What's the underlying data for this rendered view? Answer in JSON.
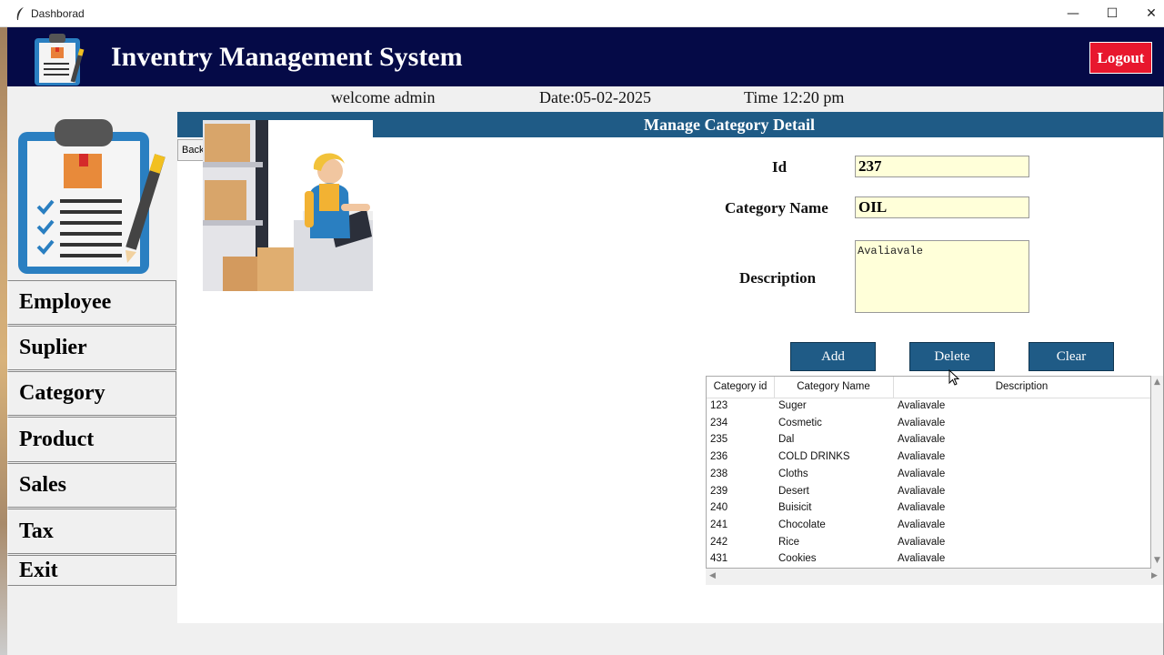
{
  "window": {
    "title": "Dashborad",
    "controls": [
      "—",
      "☐",
      "✕"
    ]
  },
  "header": {
    "title": "Inventry Management System",
    "logout_label": "Logout"
  },
  "info": {
    "welcome": "welcome admin",
    "date": "Date:05-02-2025",
    "time": "Time 12:20 pm"
  },
  "sidebar": {
    "items": [
      {
        "label": "Employee"
      },
      {
        "label": "Suplier"
      },
      {
        "label": "Category"
      },
      {
        "label": "Product"
      },
      {
        "label": "Sales"
      },
      {
        "label": "Tax"
      },
      {
        "label": "Exit"
      }
    ]
  },
  "content": {
    "title": "Manage Category Detail",
    "back_label": "Back"
  },
  "form": {
    "id_label": "Id",
    "id_value": "237",
    "name_label": "Category Name",
    "name_value": "OIL",
    "desc_label": "Description",
    "desc_value": "Avaliavale"
  },
  "buttons": {
    "add": "Add",
    "delete": "Delete",
    "clear": "Clear"
  },
  "table": {
    "columns": [
      "Category id",
      "Category Name",
      "Description"
    ],
    "rows": [
      [
        "123",
        "Suger",
        "Avaliavale"
      ],
      [
        "234",
        "Cosmetic",
        "Avaliavale"
      ],
      [
        "235",
        "Dal",
        "Avaliavale"
      ],
      [
        "236",
        "COLD DRINKS",
        "Avaliavale"
      ],
      [
        "238",
        "Cloths",
        "Avaliavale"
      ],
      [
        "239",
        "Desert",
        "Avaliavale"
      ],
      [
        "240",
        "Buisicit",
        "Avaliavale"
      ],
      [
        "241",
        "Chocolate",
        "Avaliavale"
      ],
      [
        "242",
        "Rice",
        "Avaliavale"
      ],
      [
        "431",
        "Cookies",
        "Avaliavale"
      ]
    ]
  },
  "colors": {
    "header_bg": "#050a47",
    "accent": "#1f5b86",
    "logout": "#e8172e",
    "input_bg": "#ffffd9"
  }
}
